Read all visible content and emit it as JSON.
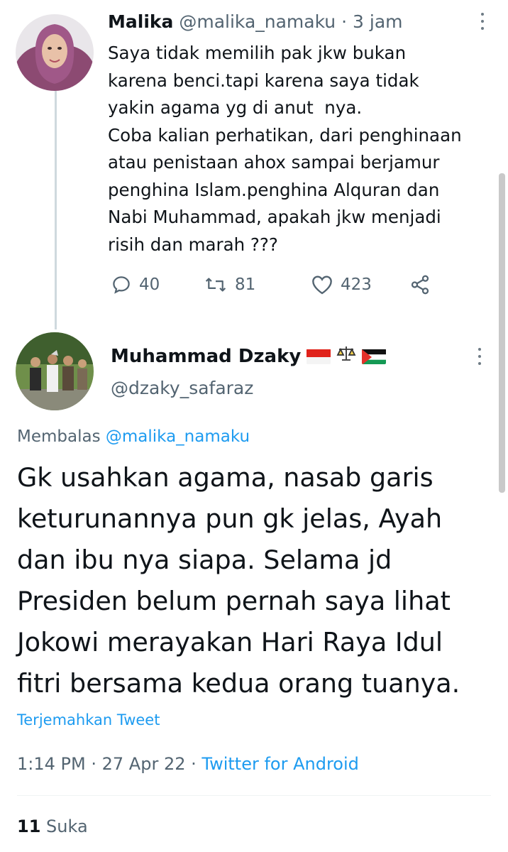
{
  "tweet1": {
    "name": "Malika",
    "handle": "@malika_namaku",
    "separator": "·",
    "time": "3 jam",
    "text": "Saya tidak memilih pak jkw bukan\nkarena benci.tapi karena saya tidak\nyakin agama yg di anut  nya.\nCoba kalian perhatikan, dari penghinaan\natau penistaan ahox sampai berjamur\npenghina Islam.penghina Alquran dan\nNabi Muhammad, apakah jkw menjadi\nrisih dan marah ???",
    "replies": "40",
    "retweets": "81",
    "likes": "423"
  },
  "tweet2": {
    "name": "Muhammad Dzaky",
    "name_emojis": [
      "indonesia-flag",
      "scales-emoji",
      "palestine-flag"
    ],
    "handle": "@dzaky_safaraz",
    "reply_prefix": "Membalas",
    "reply_to": "@malika_namaku",
    "text": "Gk usahkan agama, nasab garis\nketurunannya pun gk jelas, Ayah\ndan ibu nya siapa. Selama jd\nPresiden belum pernah saya lihat\nJokowi merayakan Hari Raya Idul\nfitri bersama kedua orang tuanya.",
    "translate": "Terjemahkan Tweet",
    "time": "1:14 PM",
    "sep": "·",
    "date": "27 Apr 22",
    "sep2": "·",
    "source": "Twitter for Android",
    "like_count": "11",
    "like_label": "Suka"
  },
  "colors": {
    "accent": "#1d9bf0",
    "secondary_text": "#536471",
    "thread_line": "#cfd9de"
  }
}
